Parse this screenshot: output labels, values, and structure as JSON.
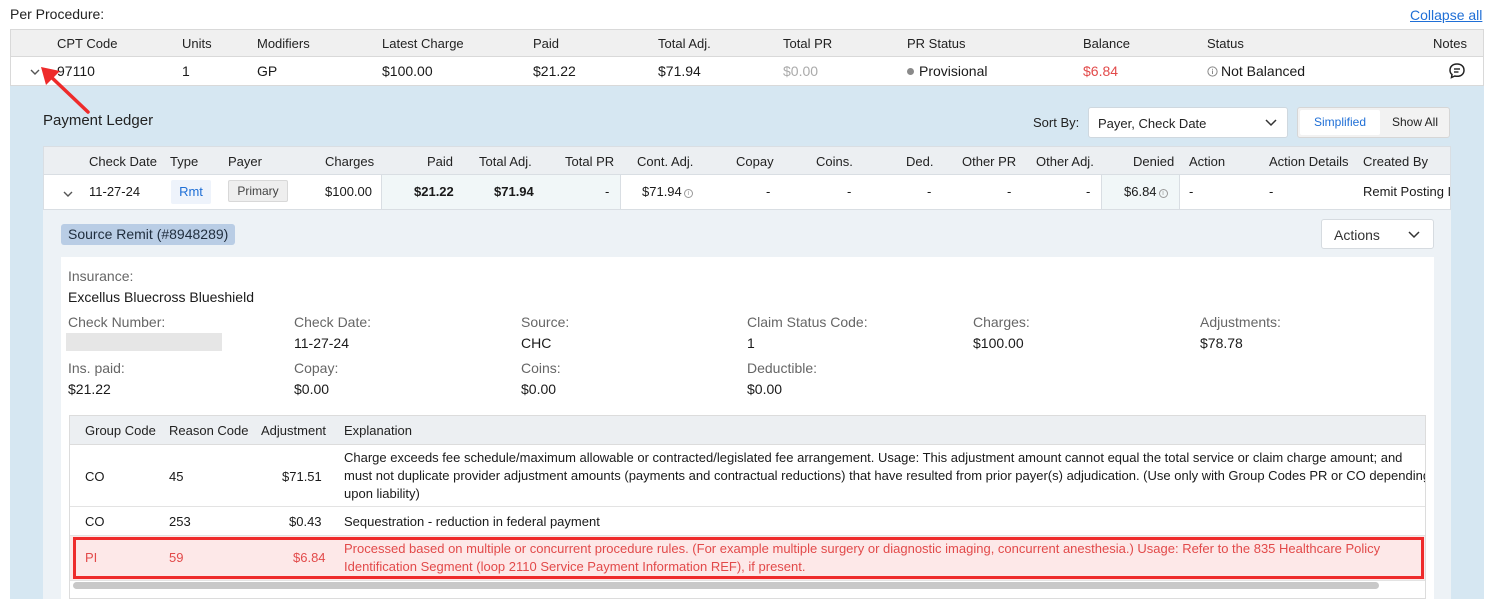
{
  "page": {
    "title": "Per Procedure:",
    "collapse_all": "Collapse all"
  },
  "procedure": {
    "headers": [
      "CPT Code",
      "Units",
      "Modifiers",
      "Latest Charge",
      "Paid",
      "Total Adj.",
      "Total PR",
      "PR Status",
      "Balance",
      "Status",
      "Notes"
    ],
    "row": {
      "cpt": "97110",
      "units": "1",
      "modifiers": "GP",
      "latest_charge": "$100.00",
      "paid": "$21.22",
      "total_adj": "$71.94",
      "total_pr": "$0.00",
      "pr_status": "Provisional",
      "balance": "$6.84",
      "status": "Not Balanced"
    }
  },
  "ledger": {
    "title": "Payment Ledger",
    "sort_label": "Sort By:",
    "sort_value": "Payer, Check Date",
    "view_simplified": "Simplified",
    "view_show_all": "Show All",
    "headers": [
      "Check Date",
      "Type",
      "Payer",
      "Charges",
      "Paid",
      "Total Adj.",
      "Total PR",
      "Cont. Adj.",
      "Copay",
      "Coins.",
      "Ded.",
      "Other PR",
      "Other Adj.",
      "Denied",
      "Action",
      "Action Details",
      "Created By"
    ],
    "row": {
      "check_date": "11-27-24",
      "type": "Rmt",
      "payer": "Primary",
      "charges": "$100.00",
      "paid": "$21.22",
      "total_adj": "$71.94",
      "total_pr": "-",
      "cont_adj": "$71.94",
      "copay": "-",
      "coins": "-",
      "ded": "-",
      "other_pr": "-",
      "other_adj": "-",
      "denied": "$6.84",
      "action": "-",
      "action_details": "-",
      "created_by": "Remit Posting I"
    }
  },
  "remit": {
    "badge": "Source Remit (#8948289)",
    "actions_label": "Actions",
    "insurance_label": "Insurance:",
    "insurance_value": "Excellus Bluecross Blueshield",
    "fields": [
      {
        "label": "Check Number:",
        "value": ""
      },
      {
        "label": "Check Date:",
        "value": "11-27-24"
      },
      {
        "label": "Source:",
        "value": "CHC"
      },
      {
        "label": "Claim Status Code:",
        "value": "1"
      },
      {
        "label": "Charges:",
        "value": "$100.00"
      },
      {
        "label": "Adjustments:",
        "value": "$78.78"
      },
      {
        "label": "Ins. paid:",
        "value": "$21.22"
      },
      {
        "label": "Copay:",
        "value": "$0.00"
      },
      {
        "label": "Coins:",
        "value": "$0.00"
      },
      {
        "label": "Deductible:",
        "value": "$0.00"
      }
    ],
    "adjustments": {
      "headers": [
        "Group Code",
        "Reason Code",
        "Adjustment",
        "Explanation"
      ],
      "rows": [
        {
          "group": "CO",
          "reason": "45",
          "amount": "$71.51",
          "explanation": "Charge exceeds fee schedule/maximum allowable or contracted/legislated fee arrangement. Usage: This adjustment amount cannot equal the total service or claim charge amount; and must not duplicate provider adjustment amounts (payments and contractual reductions) that have resulted from prior payer(s) adjudication. (Use only with Group Codes PR or CO depending upon liability)"
        },
        {
          "group": "CO",
          "reason": "253",
          "amount": "$0.43",
          "explanation": "Sequestration - reduction in federal payment"
        },
        {
          "group": "PI",
          "reason": "59",
          "amount": "$6.84",
          "explanation": "Processed based on multiple or concurrent procedure rules. (For example multiple surgery or diagnostic imaging, concurrent anesthesia.) Usage: Refer to the 835 Healthcare Policy Identification Segment (loop 2110 Service Payment Information REF), if present."
        }
      ]
    }
  },
  "colors": {
    "accent": "#1f6fd6",
    "alert": "#e24a4a",
    "highlight_border": "#ee2b2b",
    "ledger_bg": "#d6e7f2"
  }
}
